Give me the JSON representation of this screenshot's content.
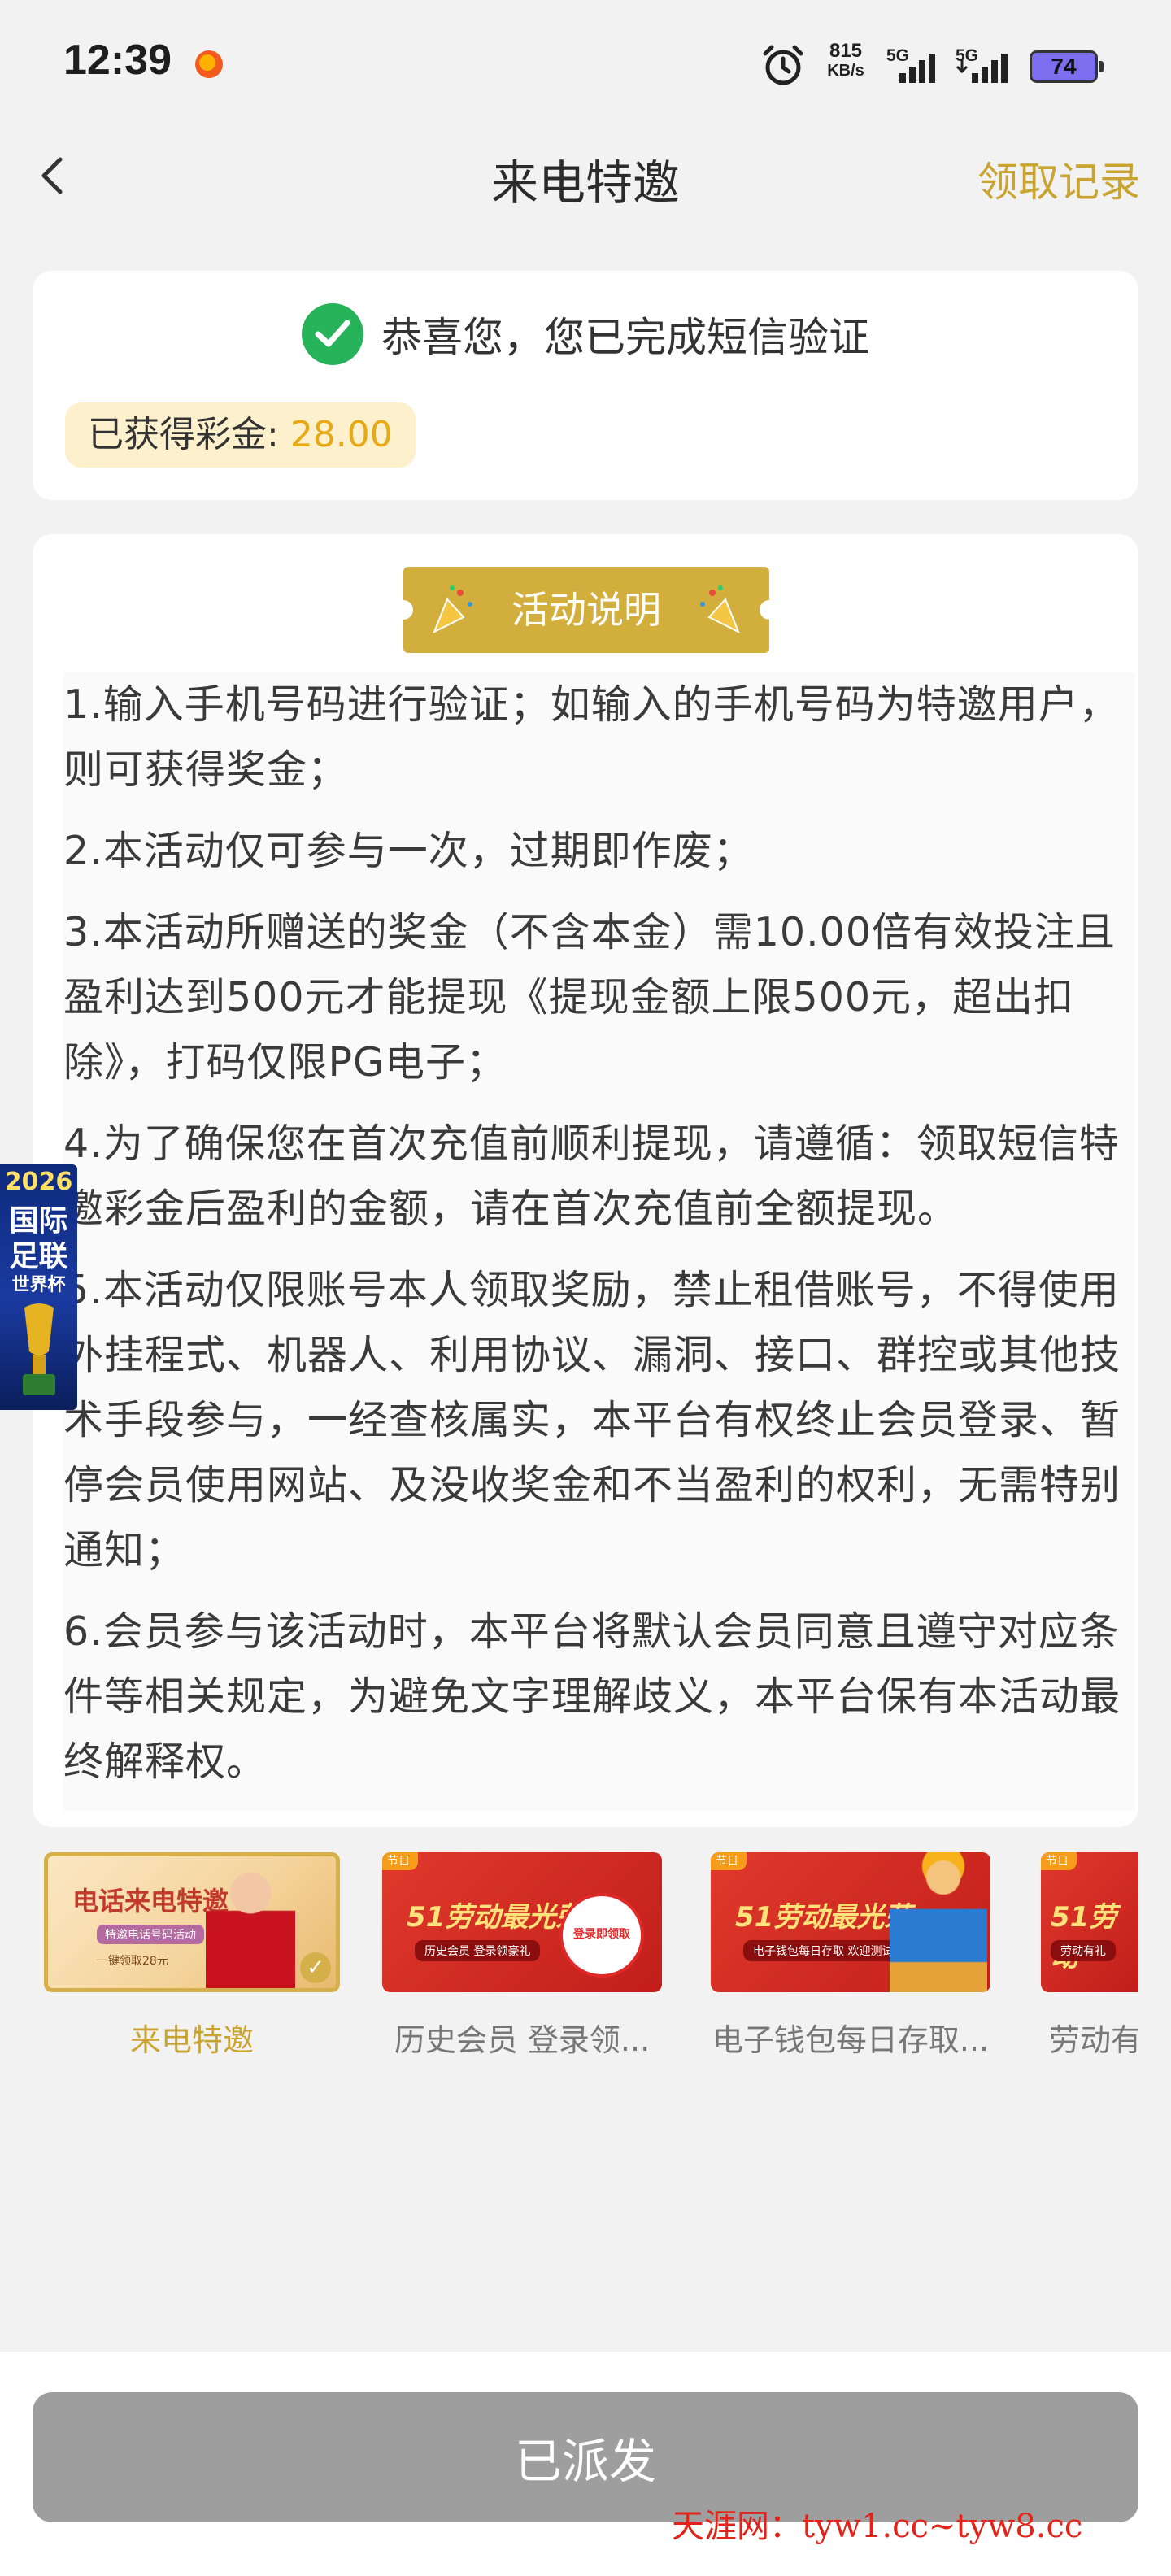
{
  "status_bar": {
    "time": "12:39",
    "speed_value": "815",
    "speed_unit": "KB/s",
    "network1": "5G",
    "network2": "5G",
    "battery": "74"
  },
  "nav": {
    "title": "来电特邀",
    "right_link": "领取记录",
    "back_icon": "chevron-left-icon"
  },
  "verification": {
    "message": "恭喜您，您已完成短信验证",
    "bonus_label": "已获得彩金: ",
    "bonus_amount": "28.00"
  },
  "activity": {
    "tag_label": "活动说明",
    "rules": [
      "1.输入手机号码进行验证；如输入的手机号码为特邀用户，则可获得奖金；",
      "2.本活动仅可参与一次，过期即作废；",
      "3.本活动所赠送的奖金（不含本金）需10.00倍有效投注且盈利达到500元才能提现《提现金额上限500元，超出扣除》，打码仅限PG电子；",
      "4.为了确保您在首次充值前顺利提现，请遵循：领取短信特邀彩金后盈利的金额，请在首次充值前全额提现。",
      "5.本活动仅限账号本人领取奖励，禁止租借账号，不得使用外挂程式、机器人、利用协议、漏洞、接口、群控或其他技术手段参与，一经查核属实，本平台有权终止会员登录、暂停会员使用网站、及没收奖金和不当盈利的权利，无需特别通知；",
      "6.会员参与该活动时，本平台将默认会员同意且遵守对应条件等相关规定，为避免文字理解歧义，本平台保有本活动最终解释权。"
    ]
  },
  "side_banner": {
    "line1": "2026",
    "line2": "国际",
    "line3": "足联",
    "line4": "世界杯"
  },
  "carousel": {
    "items": [
      {
        "label": "来电特邀",
        "banner_title": "电话来电特邀",
        "banner_sub": "特邀电话号码活动",
        "banner_sub2": "一键领取28元"
      },
      {
        "label": "历史会员 登录领...",
        "banner_title": "51劳动最光荣",
        "banner_sub": "历史会员 登录领豪礼",
        "stamp": "登录即领取",
        "badge": "节日"
      },
      {
        "label": "电子钱包每日存取...",
        "banner_title": "51劳动最光荣",
        "banner_sub": "电子钱包每日存取 欢迎测试",
        "badge": "节日"
      },
      {
        "label": "劳动有",
        "banner_title": "51劳动",
        "banner_sub": "劳动有礼",
        "badge": "节日"
      }
    ]
  },
  "footer": {
    "button_label": "已派发",
    "watermark": "天涯网：tyw1.cc~tyw8.cc"
  },
  "colors": {
    "accent_gold": "#c9a431",
    "success_green": "#27b35a",
    "disabled_button": "#9e9e9e",
    "bonus_amount": "#e8a917"
  }
}
